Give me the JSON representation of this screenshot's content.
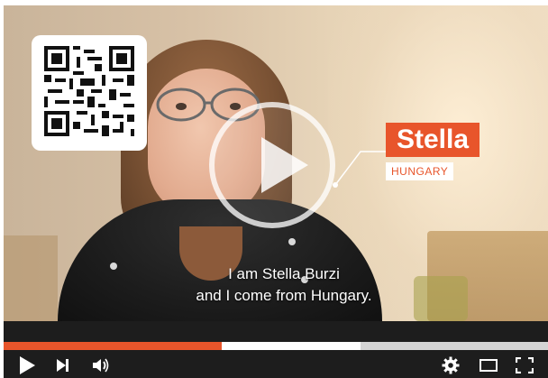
{
  "player": {
    "speaker_name": "Stella",
    "speaker_country": "HUNGARY",
    "subtitle_line1": "I am Stella Burzi",
    "subtitle_line2": "and I come from Hungary.",
    "accent_color": "#e8552b",
    "progress": {
      "played_fraction": 0.4,
      "buffered_fraction": 0.655
    }
  },
  "controls": {
    "play_icon": "play-icon",
    "next_icon": "skip-next-icon",
    "volume_icon": "volume-icon",
    "settings_icon": "gear-icon",
    "theater_icon": "theater-mode-icon",
    "fullscreen_icon": "fullscreen-icon"
  }
}
